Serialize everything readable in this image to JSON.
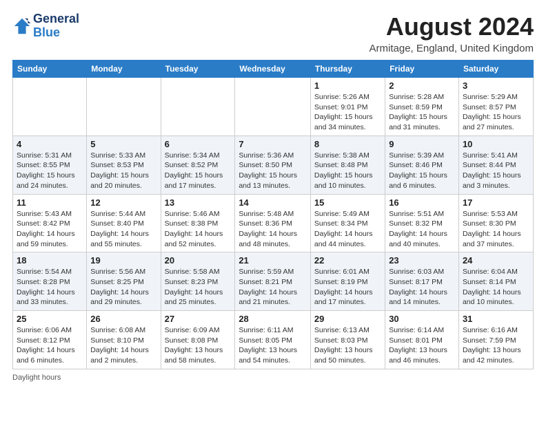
{
  "header": {
    "logo_line1": "General",
    "logo_line2": "Blue",
    "month_title": "August 2024",
    "location": "Armitage, England, United Kingdom"
  },
  "days_of_week": [
    "Sunday",
    "Monday",
    "Tuesday",
    "Wednesday",
    "Thursday",
    "Friday",
    "Saturday"
  ],
  "footer": {
    "note": "Daylight hours"
  },
  "weeks": [
    [
      {
        "day": "",
        "info": ""
      },
      {
        "day": "",
        "info": ""
      },
      {
        "day": "",
        "info": ""
      },
      {
        "day": "",
        "info": ""
      },
      {
        "day": "1",
        "info": "Sunrise: 5:26 AM\nSunset: 9:01 PM\nDaylight: 15 hours\nand 34 minutes."
      },
      {
        "day": "2",
        "info": "Sunrise: 5:28 AM\nSunset: 8:59 PM\nDaylight: 15 hours\nand 31 minutes."
      },
      {
        "day": "3",
        "info": "Sunrise: 5:29 AM\nSunset: 8:57 PM\nDaylight: 15 hours\nand 27 minutes."
      }
    ],
    [
      {
        "day": "4",
        "info": "Sunrise: 5:31 AM\nSunset: 8:55 PM\nDaylight: 15 hours\nand 24 minutes."
      },
      {
        "day": "5",
        "info": "Sunrise: 5:33 AM\nSunset: 8:53 PM\nDaylight: 15 hours\nand 20 minutes."
      },
      {
        "day": "6",
        "info": "Sunrise: 5:34 AM\nSunset: 8:52 PM\nDaylight: 15 hours\nand 17 minutes."
      },
      {
        "day": "7",
        "info": "Sunrise: 5:36 AM\nSunset: 8:50 PM\nDaylight: 15 hours\nand 13 minutes."
      },
      {
        "day": "8",
        "info": "Sunrise: 5:38 AM\nSunset: 8:48 PM\nDaylight: 15 hours\nand 10 minutes."
      },
      {
        "day": "9",
        "info": "Sunrise: 5:39 AM\nSunset: 8:46 PM\nDaylight: 15 hours\nand 6 minutes."
      },
      {
        "day": "10",
        "info": "Sunrise: 5:41 AM\nSunset: 8:44 PM\nDaylight: 15 hours\nand 3 minutes."
      }
    ],
    [
      {
        "day": "11",
        "info": "Sunrise: 5:43 AM\nSunset: 8:42 PM\nDaylight: 14 hours\nand 59 minutes."
      },
      {
        "day": "12",
        "info": "Sunrise: 5:44 AM\nSunset: 8:40 PM\nDaylight: 14 hours\nand 55 minutes."
      },
      {
        "day": "13",
        "info": "Sunrise: 5:46 AM\nSunset: 8:38 PM\nDaylight: 14 hours\nand 52 minutes."
      },
      {
        "day": "14",
        "info": "Sunrise: 5:48 AM\nSunset: 8:36 PM\nDaylight: 14 hours\nand 48 minutes."
      },
      {
        "day": "15",
        "info": "Sunrise: 5:49 AM\nSunset: 8:34 PM\nDaylight: 14 hours\nand 44 minutes."
      },
      {
        "day": "16",
        "info": "Sunrise: 5:51 AM\nSunset: 8:32 PM\nDaylight: 14 hours\nand 40 minutes."
      },
      {
        "day": "17",
        "info": "Sunrise: 5:53 AM\nSunset: 8:30 PM\nDaylight: 14 hours\nand 37 minutes."
      }
    ],
    [
      {
        "day": "18",
        "info": "Sunrise: 5:54 AM\nSunset: 8:28 PM\nDaylight: 14 hours\nand 33 minutes."
      },
      {
        "day": "19",
        "info": "Sunrise: 5:56 AM\nSunset: 8:25 PM\nDaylight: 14 hours\nand 29 minutes."
      },
      {
        "day": "20",
        "info": "Sunrise: 5:58 AM\nSunset: 8:23 PM\nDaylight: 14 hours\nand 25 minutes."
      },
      {
        "day": "21",
        "info": "Sunrise: 5:59 AM\nSunset: 8:21 PM\nDaylight: 14 hours\nand 21 minutes."
      },
      {
        "day": "22",
        "info": "Sunrise: 6:01 AM\nSunset: 8:19 PM\nDaylight: 14 hours\nand 17 minutes."
      },
      {
        "day": "23",
        "info": "Sunrise: 6:03 AM\nSunset: 8:17 PM\nDaylight: 14 hours\nand 14 minutes."
      },
      {
        "day": "24",
        "info": "Sunrise: 6:04 AM\nSunset: 8:14 PM\nDaylight: 14 hours\nand 10 minutes."
      }
    ],
    [
      {
        "day": "25",
        "info": "Sunrise: 6:06 AM\nSunset: 8:12 PM\nDaylight: 14 hours\nand 6 minutes."
      },
      {
        "day": "26",
        "info": "Sunrise: 6:08 AM\nSunset: 8:10 PM\nDaylight: 14 hours\nand 2 minutes."
      },
      {
        "day": "27",
        "info": "Sunrise: 6:09 AM\nSunset: 8:08 PM\nDaylight: 13 hours\nand 58 minutes."
      },
      {
        "day": "28",
        "info": "Sunrise: 6:11 AM\nSunset: 8:05 PM\nDaylight: 13 hours\nand 54 minutes."
      },
      {
        "day": "29",
        "info": "Sunrise: 6:13 AM\nSunset: 8:03 PM\nDaylight: 13 hours\nand 50 minutes."
      },
      {
        "day": "30",
        "info": "Sunrise: 6:14 AM\nSunset: 8:01 PM\nDaylight: 13 hours\nand 46 minutes."
      },
      {
        "day": "31",
        "info": "Sunrise: 6:16 AM\nSunset: 7:59 PM\nDaylight: 13 hours\nand 42 minutes."
      }
    ]
  ]
}
